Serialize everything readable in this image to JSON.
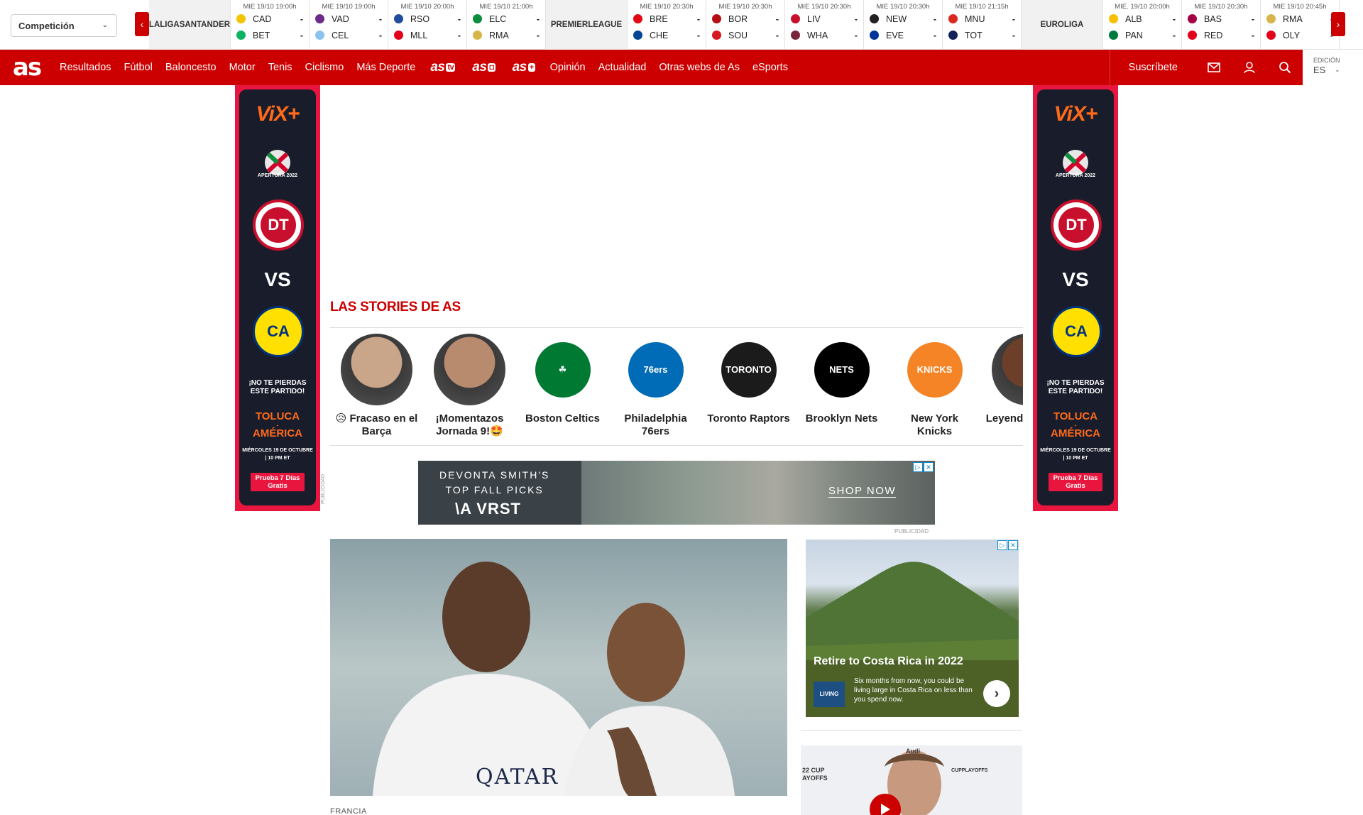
{
  "scorebar": {
    "competition_select": "Competición",
    "groups": [
      {
        "league": [
          "LALIGA",
          "SANTANDER"
        ],
        "matches": [
          {
            "time": "MIE 19/10 19:00h",
            "home": "CAD",
            "away": "BET",
            "home_score": "-",
            "away_score": "-",
            "home_color": "#f5c400",
            "away_color": "#0bb363"
          },
          {
            "time": "MIE 19/10 19:00h",
            "home": "VAD",
            "away": "CEL",
            "home_score": "-",
            "away_score": "-",
            "home_color": "#6b2a8c",
            "away_color": "#8ac3ee"
          },
          {
            "time": "MIE 19/10 20:00h",
            "home": "RSO",
            "away": "MLL",
            "home_score": "-",
            "away_score": "-",
            "home_color": "#1f4d9c",
            "away_color": "#e2001a"
          },
          {
            "time": "MIE 19/10 21:00h",
            "home": "ELC",
            "away": "RMA",
            "home_score": "-",
            "away_score": "-",
            "home_color": "#0b8d3c",
            "away_color": "#d8b54a"
          }
        ]
      },
      {
        "league": [
          "PREMIER",
          "LEAGUE"
        ],
        "matches": [
          {
            "time": "MIE 19/10 20:30h",
            "home": "BRE",
            "away": "CHE",
            "home_score": "-",
            "away_score": "-",
            "home_color": "#e30613",
            "away_color": "#034694"
          },
          {
            "time": "MIE 19/10 20:30h",
            "home": "BOR",
            "away": "SOU",
            "home_score": "-",
            "away_score": "-",
            "home_color": "#b50e12",
            "away_color": "#d71920"
          },
          {
            "time": "MIE 19/10 20:30h",
            "home": "LIV",
            "away": "WHA",
            "home_score": "-",
            "away_score": "-",
            "home_color": "#c8102e",
            "away_color": "#7a263a"
          },
          {
            "time": "MIE 19/10 20:30h",
            "home": "NEW",
            "away": "EVE",
            "home_score": "-",
            "away_score": "-",
            "home_color": "#241f20",
            "away_color": "#003399"
          },
          {
            "time": "MIE 19/10 21:15h",
            "home": "MNU",
            "away": "TOT",
            "home_score": "-",
            "away_score": "-",
            "home_color": "#da291c",
            "away_color": "#132257"
          }
        ]
      },
      {
        "league": [
          "EUROLIGA"
        ],
        "matches": [
          {
            "time": "MIE. 19/10 20:00h",
            "home": "ALB",
            "away": "PAN",
            "home_score": "-",
            "away_score": "-",
            "home_color": "#f6c100",
            "away_color": "#007a3d"
          },
          {
            "time": "MIE 19/10 20:30h",
            "home": "BAS",
            "away": "RED",
            "home_score": "-",
            "away_score": "-",
            "home_color": "#a50044",
            "away_color": "#e2001a"
          },
          {
            "time": "MIE 19/10 20:45h",
            "home": "RMA",
            "away": "OLY",
            "home_score": "-",
            "away_score": "-",
            "home_color": "#d8b54a",
            "away_color": "#e2001a"
          }
        ]
      }
    ]
  },
  "nav": {
    "logo": "as",
    "items": [
      "Resultados",
      "Fútbol",
      "Baloncesto",
      "Motor",
      "Tenis",
      "Ciclismo",
      "Más Deporte"
    ],
    "brand_logos": [
      {
        "text": "as",
        "badge": "tv"
      },
      {
        "text": "as",
        "badge": "◘"
      },
      {
        "text": "as",
        "badge": "+"
      }
    ],
    "items_after": [
      "Opinión",
      "Actualidad",
      "Otras webs de As",
      "eSports"
    ],
    "subscribe": "Suscríbete",
    "edition_label": "EDICIÓN",
    "edition_value": "ES"
  },
  "side_ad": {
    "brand": "ViX+",
    "apertura": "APERTURA 2022",
    "toluca_crest": "DT",
    "vs": "VS",
    "america_crest": "CA",
    "headline_1": "¡NO TE PIERDAS",
    "headline_2": "ESTE PARTIDO!",
    "teams_1": "TOLUCA",
    "teams_sep": "-",
    "teams_2": "AMÉRICA",
    "date_1": "MIÉRCOLES 19 DE OCTUBRE",
    "date_2": "| 10 PM ET",
    "cta_1": "Prueba 7 Días",
    "cta_2": "Gratis"
  },
  "stories": {
    "title": "LAS STORIES DE AS",
    "items": [
      {
        "label": "😥 Fracaso en el Barça",
        "color": "#c9a58a",
        "kind": "photo"
      },
      {
        "label": "¡Momentazos Jornada 9!🤩",
        "color": "#b88a6e",
        "kind": "photo"
      },
      {
        "label": "Boston Celtics",
        "color": "#007a33",
        "kind": "logo",
        "logo_text": "☘"
      },
      {
        "label": "Philadelphia 76ers",
        "color": "#006bb6",
        "kind": "logo",
        "logo_text": "76ers"
      },
      {
        "label": "Toronto Raptors",
        "color": "#1b1b1b",
        "kind": "logo",
        "logo_text": "TORONTO"
      },
      {
        "label": "Brooklyn Nets",
        "color": "#000000",
        "kind": "logo",
        "logo_text": "NETS"
      },
      {
        "label": "New York Knicks",
        "color": "#f58426",
        "kind": "logo",
        "logo_text": "KNICKS"
      },
      {
        "label": "Leyend mate a L",
        "color": "#6b3f2a",
        "kind": "photo"
      }
    ]
  },
  "banner_ad": {
    "line_1": "DEVONTA SMITH'S",
    "line_2": "TOP FALL PICKS",
    "brand": "\\A VRST",
    "cta": "SHOP NOW",
    "side_label": "PUBLICIDAD"
  },
  "pub_label": "PUBLICIDAD",
  "main_article": {
    "section": "FRANCIA",
    "image_text": "QATAR"
  },
  "right_ad": {
    "title": "Retire to Costa Rica in 2022",
    "text": "Six months from now, you could be living large in Costa Rica on less than you spend now.",
    "logo": "LIVING"
  },
  "video": {
    "brand_1": "Audi",
    "brand_2": "CUPPLAYOFFS",
    "caption": "22 CUP AYOFFS"
  }
}
